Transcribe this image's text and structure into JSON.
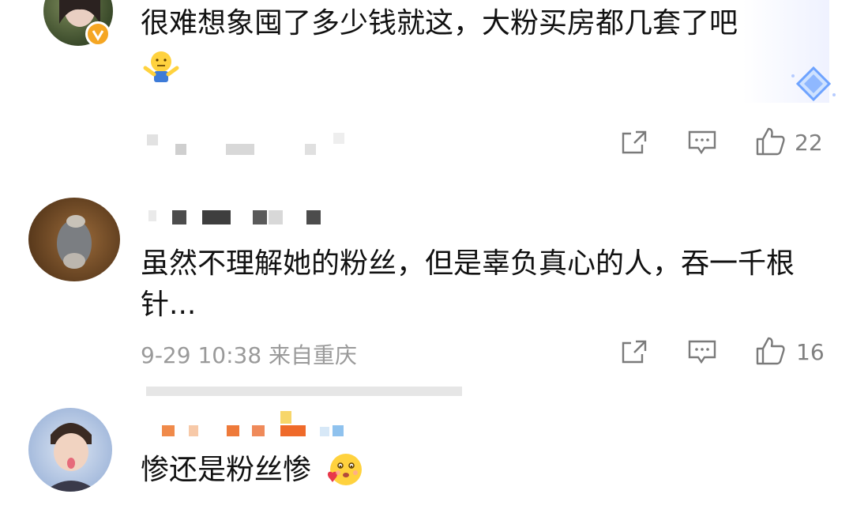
{
  "comments": [
    {
      "text": "很难想象囤了多少钱就这，大粉买房都几套了吧",
      "emoji": "shrug-emoji",
      "meta": "",
      "likes": "22",
      "verified": true
    },
    {
      "text": "虽然不理解她的粉丝，但是辜负真心的人，吞一千根针...",
      "meta": "9-29 10:38 来自重庆",
      "likes": "16",
      "verified": false
    },
    {
      "text": "惨还是粉丝惨",
      "emoji": "heart-face-emoji",
      "verified": false
    }
  ],
  "colors": {
    "meta_text": "#9a9a9a",
    "body_text": "#111111",
    "verified_badge": "#f5a623"
  },
  "icons": [
    "share-icon",
    "comment-icon",
    "like-icon",
    "verified-badge-icon",
    "vip-diamond-icon"
  ]
}
